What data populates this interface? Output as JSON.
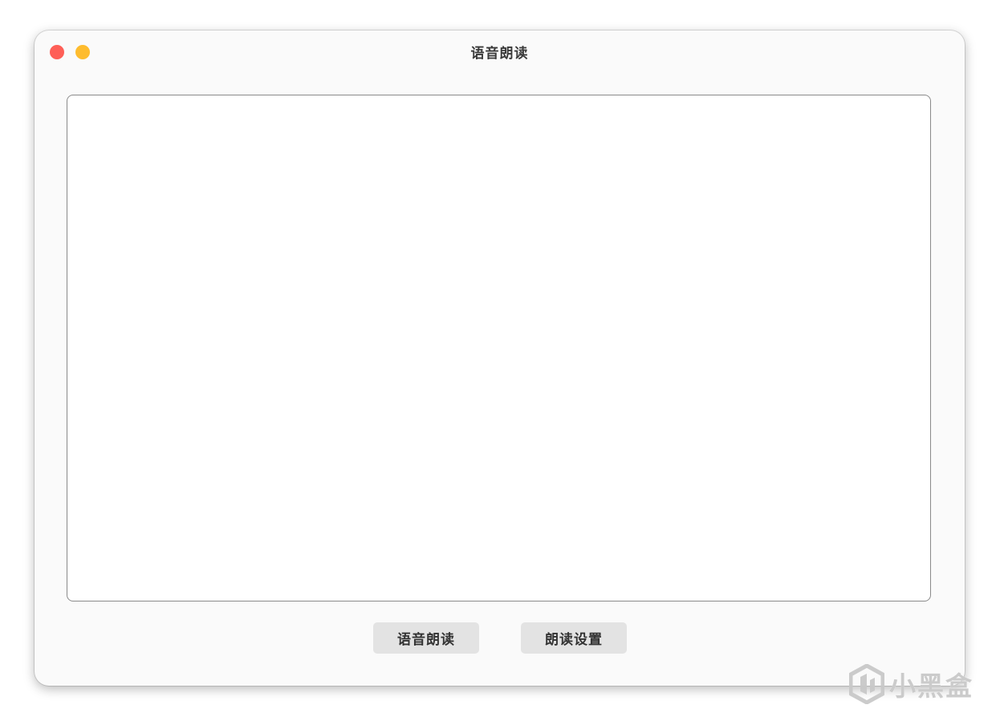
{
  "window": {
    "title": "语音朗读"
  },
  "editor": {
    "value": "",
    "placeholder": ""
  },
  "buttons": {
    "read_label": "语音朗读",
    "settings_label": "朗读设置"
  },
  "watermark": {
    "text": "小黑盒"
  },
  "colors": {
    "close": "#fe5f57",
    "minimize": "#febc2e",
    "button_bg": "#e3e3e3",
    "window_bg": "#fafafa"
  },
  "icons": [
    "close-traffic-light",
    "minimize-traffic-light",
    "heybox-logo-icon"
  ]
}
